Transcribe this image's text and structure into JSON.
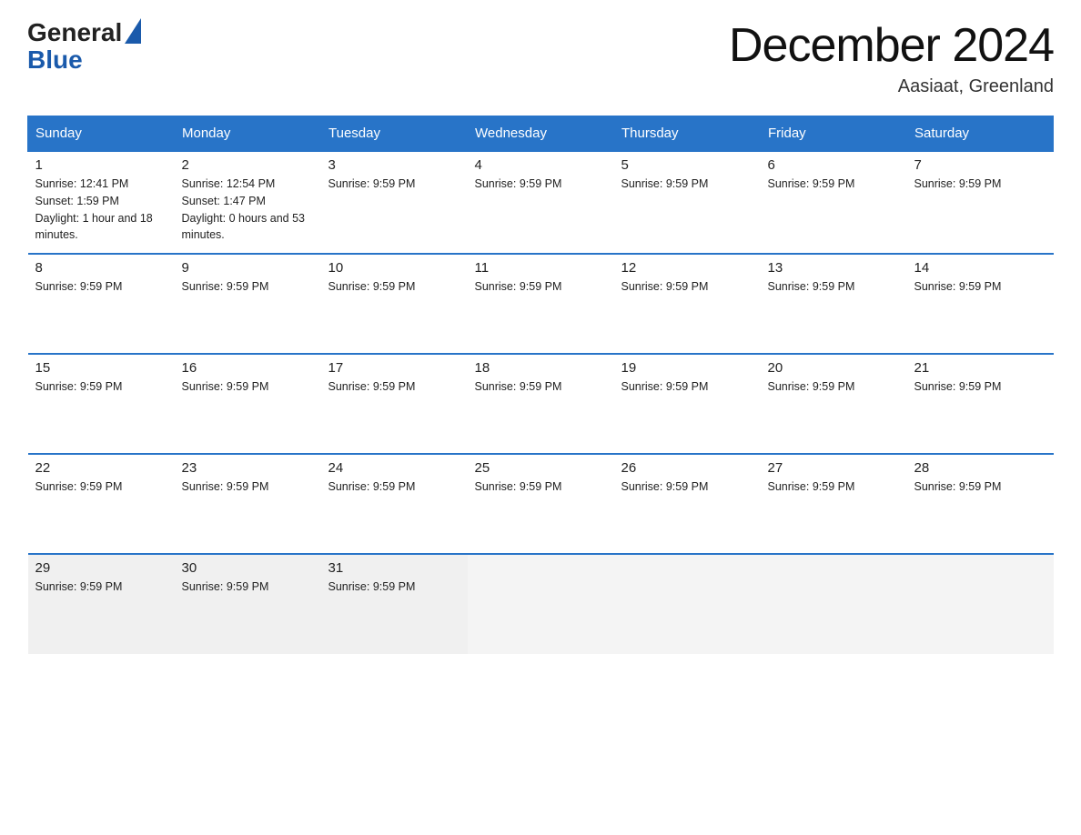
{
  "header": {
    "logo_general": "General",
    "logo_blue": "Blue",
    "month_title": "December 2024",
    "location": "Aasiaat, Greenland"
  },
  "calendar": {
    "days_of_week": [
      "Sunday",
      "Monday",
      "Tuesday",
      "Wednesday",
      "Thursday",
      "Friday",
      "Saturday"
    ],
    "weeks": [
      [
        {
          "day": "1",
          "info": "Sunrise: 12:41 PM\nSunset: 1:59 PM\nDaylight: 1 hour and 18 minutes."
        },
        {
          "day": "2",
          "info": "Sunrise: 12:54 PM\nSunset: 1:47 PM\nDaylight: 0 hours and 53 minutes."
        },
        {
          "day": "3",
          "info": "Sunrise: 9:59 PM"
        },
        {
          "day": "4",
          "info": "Sunrise: 9:59 PM"
        },
        {
          "day": "5",
          "info": "Sunrise: 9:59 PM"
        },
        {
          "day": "6",
          "info": "Sunrise: 9:59 PM"
        },
        {
          "day": "7",
          "info": "Sunrise: 9:59 PM"
        }
      ],
      [
        {
          "day": "8",
          "info": "Sunrise: 9:59 PM"
        },
        {
          "day": "9",
          "info": "Sunrise: 9:59 PM"
        },
        {
          "day": "10",
          "info": "Sunrise: 9:59 PM"
        },
        {
          "day": "11",
          "info": "Sunrise: 9:59 PM"
        },
        {
          "day": "12",
          "info": "Sunrise: 9:59 PM"
        },
        {
          "day": "13",
          "info": "Sunrise: 9:59 PM"
        },
        {
          "day": "14",
          "info": "Sunrise: 9:59 PM"
        }
      ],
      [
        {
          "day": "15",
          "info": "Sunrise: 9:59 PM"
        },
        {
          "day": "16",
          "info": "Sunrise: 9:59 PM"
        },
        {
          "day": "17",
          "info": "Sunrise: 9:59 PM"
        },
        {
          "day": "18",
          "info": "Sunrise: 9:59 PM"
        },
        {
          "day": "19",
          "info": "Sunrise: 9:59 PM"
        },
        {
          "day": "20",
          "info": "Sunrise: 9:59 PM"
        },
        {
          "day": "21",
          "info": "Sunrise: 9:59 PM"
        }
      ],
      [
        {
          "day": "22",
          "info": "Sunrise: 9:59 PM"
        },
        {
          "day": "23",
          "info": "Sunrise: 9:59 PM"
        },
        {
          "day": "24",
          "info": "Sunrise: 9:59 PM"
        },
        {
          "day": "25",
          "info": "Sunrise: 9:59 PM"
        },
        {
          "day": "26",
          "info": "Sunrise: 9:59 PM"
        },
        {
          "day": "27",
          "info": "Sunrise: 9:59 PM"
        },
        {
          "day": "28",
          "info": "Sunrise: 9:59 PM"
        }
      ],
      [
        {
          "day": "29",
          "info": "Sunrise: 9:59 PM"
        },
        {
          "day": "30",
          "info": "Sunrise: 9:59 PM"
        },
        {
          "day": "31",
          "info": "Sunrise: 9:59 PM"
        },
        {
          "day": "",
          "info": ""
        },
        {
          "day": "",
          "info": ""
        },
        {
          "day": "",
          "info": ""
        },
        {
          "day": "",
          "info": ""
        }
      ]
    ]
  }
}
